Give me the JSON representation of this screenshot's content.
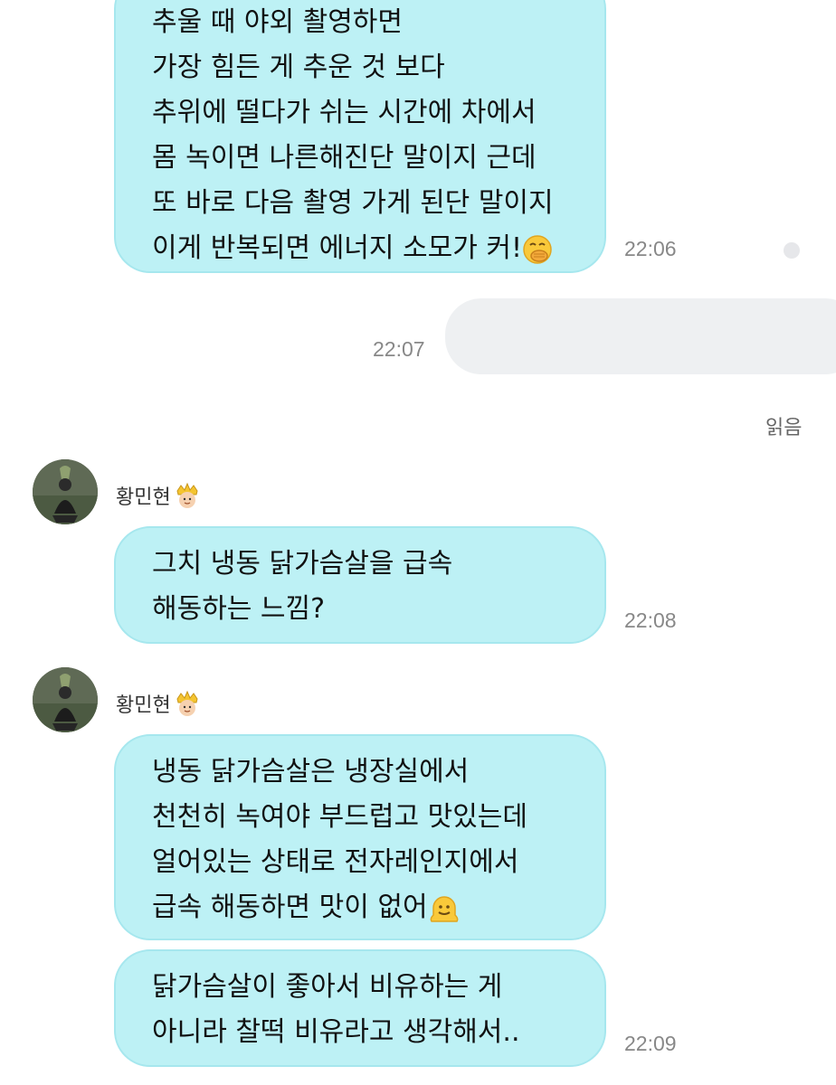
{
  "messages": [
    {
      "lines": [
        "추울 때 야외 촬영하면",
        "가장 힘든 게 추운 것 보다",
        "추위에 떨다가 쉬는 시간에 차에서",
        "몸 녹이면 나른해진단 말이지 근데",
        "또 바로 다음 촬영 가게 된단 말이지",
        "이게 반복되면 에너지 소모가 커!"
      ],
      "emoji": "face-with-hand-over-mouth",
      "time": "22:06"
    },
    {
      "time": "22:07",
      "read": "읽음"
    },
    {
      "sender": "황민현",
      "sender_emoji": "prince",
      "lines": [
        "그치 냉동 닭가슴살을 급속",
        "해동하는 느낌?"
      ],
      "time": "22:08"
    },
    {
      "sender": "황민현",
      "sender_emoji": "prince",
      "lines": [
        "냉동 닭가슴살은 냉장실에서",
        "천천히 녹여야 부드럽고 맛있는데",
        "얼어있는 상태로 전자레인지에서",
        "급속 해동하면 맛이 없어"
      ],
      "emoji": "melting-face"
    },
    {
      "lines": [
        "닭가슴살이 좋아서 비유하는 게",
        "아니라 찰떡 비유라고 생각해서.."
      ],
      "time": "22:09"
    }
  ],
  "colors": {
    "incoming_bubble": "#bdf1f5",
    "outgoing_bubble": "#eef0f2",
    "timestamp": "#888888"
  }
}
